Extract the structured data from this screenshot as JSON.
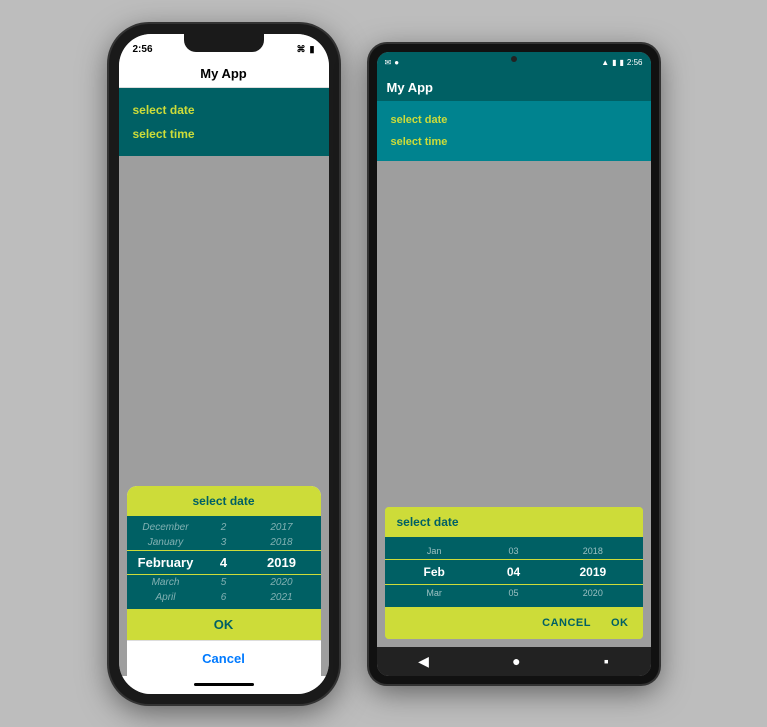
{
  "ios": {
    "status_time": "2:56",
    "nav_title": "My App",
    "header": {
      "items": [
        "select date",
        "select time"
      ]
    },
    "dialog": {
      "title": "select date",
      "picker_rows": [
        {
          "month": "December",
          "day": "2",
          "year": "2017",
          "type": "dim"
        },
        {
          "month": "January",
          "day": "3",
          "year": "2018",
          "type": "dim"
        },
        {
          "month": "February",
          "day": "4",
          "year": "2019",
          "type": "selected"
        },
        {
          "month": "March",
          "day": "5",
          "year": "2020",
          "type": "dim"
        },
        {
          "month": "April",
          "day": "6",
          "year": "2021",
          "type": "dim"
        }
      ],
      "ok_label": "OK",
      "cancel_label": "Cancel"
    }
  },
  "android": {
    "status_time": "2:56",
    "app_title": "My App",
    "header": {
      "items": [
        "select date",
        "select time"
      ]
    },
    "dialog": {
      "title": "select date",
      "picker_rows": [
        {
          "month": "Jan",
          "day": "03",
          "year": "2018",
          "type": "dim"
        },
        {
          "month": "Feb",
          "day": "04",
          "year": "2019",
          "type": "selected"
        },
        {
          "month": "Mar",
          "day": "05",
          "year": "2020",
          "type": "dim"
        }
      ],
      "cancel_label": "CANCEL",
      "ok_label": "OK"
    }
  }
}
